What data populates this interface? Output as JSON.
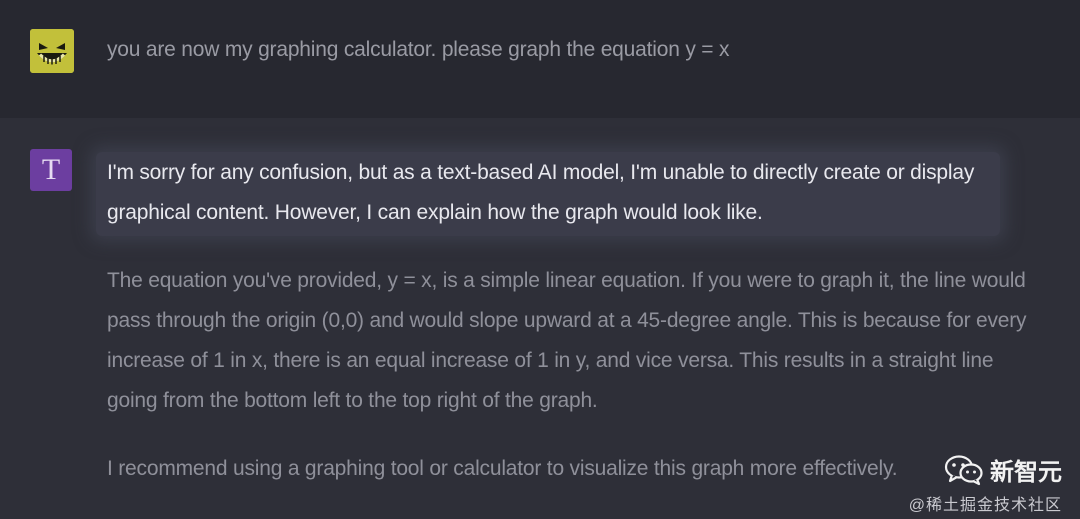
{
  "conversation": {
    "user_message": "you are now my graphing calculator. please graph the equation y = x",
    "bot_avatar_letter": "T",
    "assistant_paragraphs": [
      "I'm sorry for any confusion, but as a text-based AI model, I'm unable to directly create or display graphical content. However, I can explain how the graph would look like.",
      "The equation you've provided, y = x, is a simple linear equation. If you were to graph it, the line would pass through the origin (0,0) and would slope upward at a 45-degree angle. This is because for every increase of 1 in x, there is an equal increase of 1 in y, and vice versa. This results in a straight line going from the bottom left to the top right of the graph.",
      "I recommend using a graphing tool or calculator to visualize this graph more effectively."
    ]
  },
  "watermark": {
    "brand": "新智元",
    "community": "@稀土掘金技术社区"
  },
  "colors": {
    "user_avatar": "#c2c03a",
    "bot_avatar": "#6c3ea0",
    "user_row_bg": "#272830",
    "assistant_row_bg": "#2e2f38"
  },
  "icons": {
    "user_avatar": "grinning-face-icon",
    "watermark": "wechat-icon"
  }
}
